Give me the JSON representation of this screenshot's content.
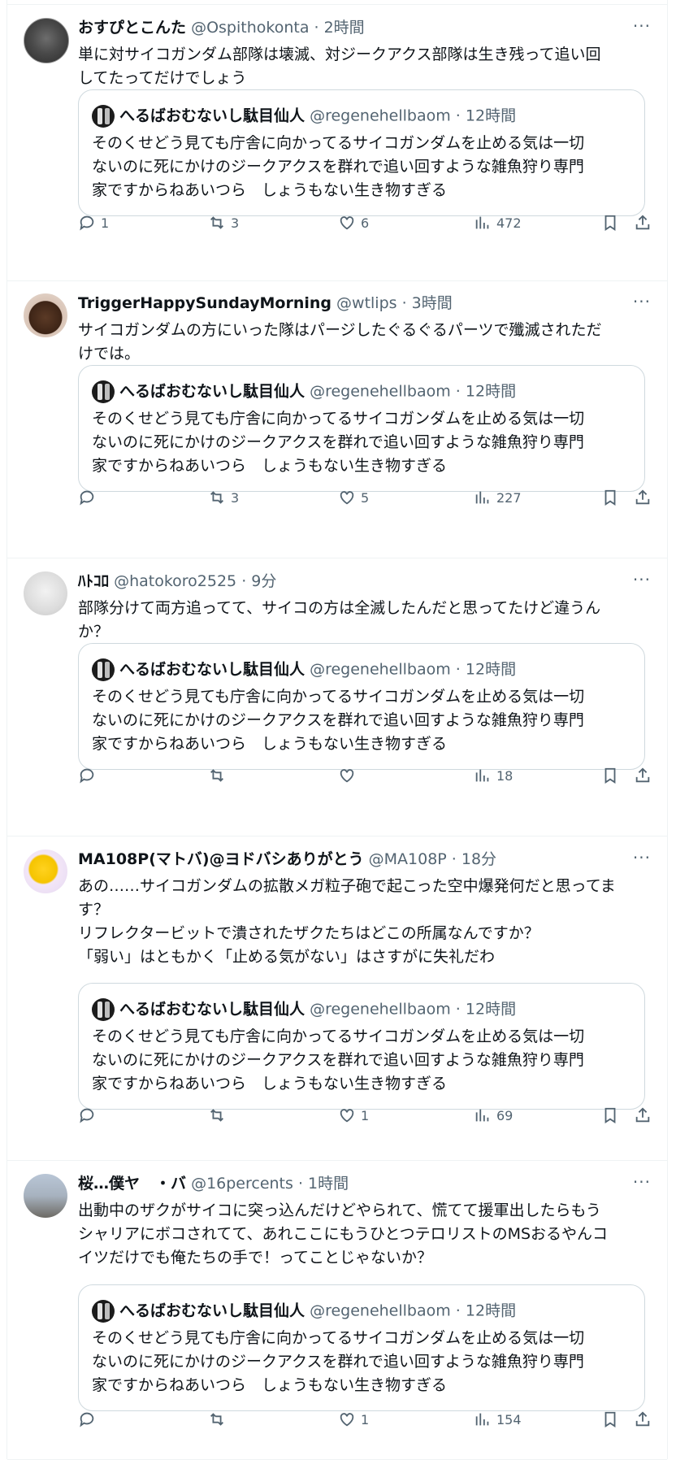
{
  "tweets": [
    {
      "name": "おすぴとこんた",
      "handle": "@Ospithokonta",
      "time": "2時間",
      "text": "単に対サイコガンダム部隊は壊滅、対ジークアクス部隊は生き残って追い回\nしてたってだけでしょう",
      "quote": {
        "name": "へるばおむないし駄目仙人",
        "handle": "@regenehellbaom",
        "time": "12時間",
        "text": "そのくせどう見ても庁舎に向かってるサイコガンダムを止める気は一切\nないのに死にかけのジークアクスを群れで追い回すような雑魚狩り専門\n家ですからねあいつら　しょうもない生き物すぎる"
      },
      "stats": {
        "replies": "1",
        "retweets": "3",
        "likes": "6",
        "views": "472"
      }
    },
    {
      "name": "TriggerHappySundayMorning",
      "handle": "@wtlips",
      "time": "3時間",
      "text": "サイコガンダムの方にいった隊はパージしたぐるぐるパーツで殲滅されただ\nけでは。",
      "quote": {
        "name": "へるばおむないし駄目仙人",
        "handle": "@regenehellbaom",
        "time": "12時間",
        "text": "そのくせどう見ても庁舎に向かってるサイコガンダムを止める気は一切\nないのに死にかけのジークアクスを群れで追い回すような雑魚狩り専門\n家ですからねあいつら　しょうもない生き物すぎる"
      },
      "stats": {
        "replies": "",
        "retweets": "3",
        "likes": "5",
        "views": "227"
      }
    },
    {
      "name": "ﾊﾄｺﾛ",
      "handle": "@hatokoro2525",
      "time": "9分",
      "text": "部隊分けて両方追ってて、サイコの方は全滅したんだと思ってたけど違うん\nか？",
      "quote": {
        "name": "へるばおむないし駄目仙人",
        "handle": "@regenehellbaom",
        "time": "12時間",
        "text": "そのくせどう見ても庁舎に向かってるサイコガンダムを止める気は一切\nないのに死にかけのジークアクスを群れで追い回すような雑魚狩り専門\n家ですからねあいつら　しょうもない生き物すぎる"
      },
      "stats": {
        "replies": "",
        "retweets": "",
        "likes": "",
        "views": "18"
      }
    },
    {
      "name": "MA108P(マトバ)@ヨドバシありがとう",
      "handle": "@MA108P",
      "time": "18分",
      "text": "あの……サイコガンダムの拡散メガ粒子砲で起こった空中爆発何だと思ってま\nす？\nリフレクタービットで潰されたザクたちはどこの所属なんですか？\n「弱い」はともかく「止める気がない」はさすがに失礼だわ",
      "quote": {
        "name": "へるばおむないし駄目仙人",
        "handle": "@regenehellbaom",
        "time": "12時間",
        "text": "そのくせどう見ても庁舎に向かってるサイコガンダムを止める気は一切\nないのに死にかけのジークアクスを群れで追い回すような雑魚狩り専門\n家ですからねあいつら　しょうもない生き物すぎる"
      },
      "stats": {
        "replies": "",
        "retweets": "",
        "likes": "1",
        "views": "69"
      }
    },
    {
      "name": "桜…僕ヤ　・バ",
      "handle": "@16percents",
      "time": "1時間",
      "text": "出動中のザクがサイコに突っ込んだけどやられて、慌てて援軍出したらもう\nシャリアにボコされてて、あれここにもうひとつテロリストのMSおるやんコ\nイツだけでも俺たちの手で！ってことじゃないか？",
      "quote": {
        "name": "へるばおむないし駄目仙人",
        "handle": "@regenehellbaom",
        "time": "12時間",
        "text": "そのくせどう見ても庁舎に向かってるサイコガンダムを止める気は一切\nないのに死にかけのジークアクスを群れで追い回すような雑魚狩り専門\n家ですからねあいつら　しょうもない生き物すぎる"
      },
      "stats": {
        "replies": "",
        "retweets": "",
        "likes": "1",
        "views": "154"
      }
    }
  ],
  "labels": {
    "separator": " · ",
    "more": "···"
  }
}
